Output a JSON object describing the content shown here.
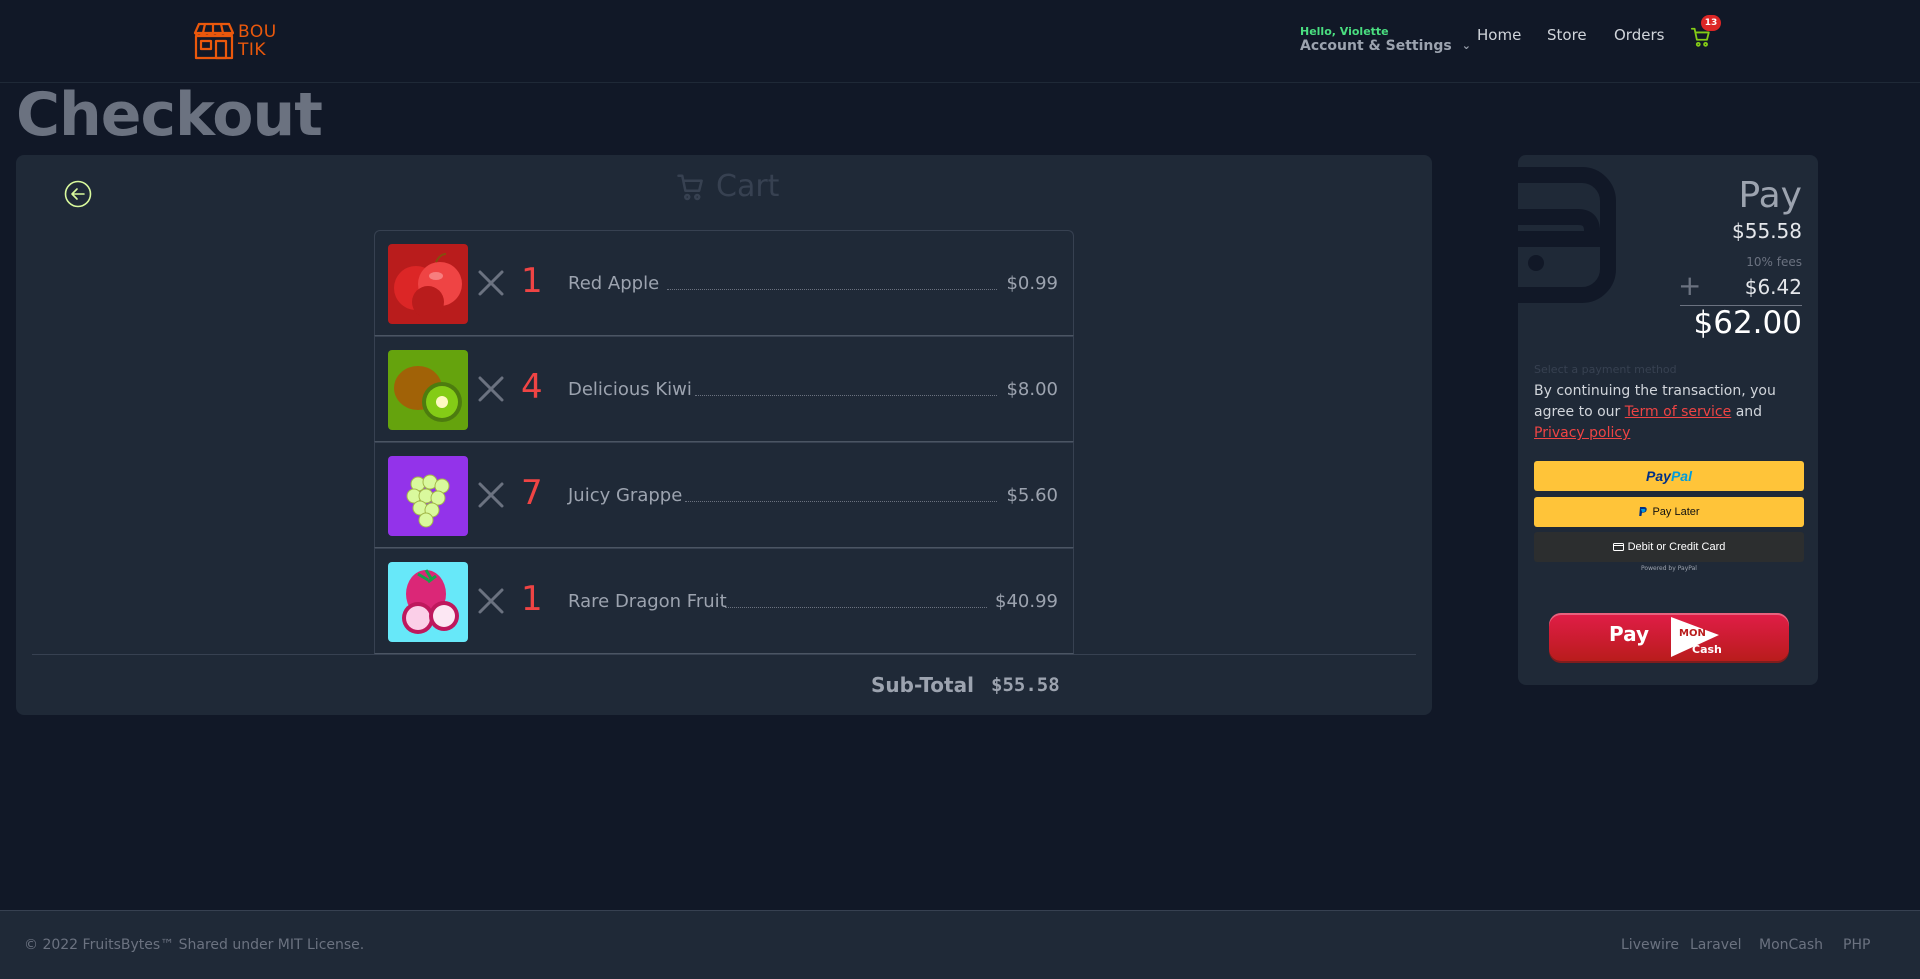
{
  "header": {
    "logo_text_1": "BOU",
    "logo_text_2": "TIK",
    "greeting": "Hello, Violette",
    "account_label": "Account & Settings",
    "nav": {
      "home": "Home",
      "store": "Store",
      "orders": "Orders"
    },
    "cart_count": "13"
  },
  "page_title": "Checkout",
  "cart": {
    "title": "Cart",
    "items": [
      {
        "qty": "1",
        "name": "Red Apple",
        "price": "$0.99"
      },
      {
        "qty": "4",
        "name": "Delicious Kiwi",
        "price": "$8.00"
      },
      {
        "qty": "7",
        "name": "Juicy Grappe",
        "price": "$5.60"
      },
      {
        "qty": "1",
        "name": "Rare Dragon Fruit",
        "price": "$40.99"
      }
    ],
    "subtotal_label": "Sub-Total",
    "subtotal_value": "$55.58"
  },
  "pay": {
    "title": "Pay",
    "amount": "$55.58",
    "fees_label": "10% fees",
    "fees_amount": "$6.42",
    "total": "$62.00",
    "method_label": "Select a payment method",
    "agree_text": "By continuing the transaction, you agree to our",
    "tos_link": "Term of service",
    "and_text": "and",
    "privacy_link": "Privacy policy",
    "paypal_1": "Pay",
    "paypal_2": "Pal",
    "paylater": "Pay Later",
    "card": "Debit or Credit Card",
    "powered": "Powered by PayPal",
    "moncash_pay": "Pay",
    "moncash_mon": "MON",
    "moncash_cash": "Cash"
  },
  "footer": {
    "copyright": "© 2022 FruitsBytes™ Shared under MIT License.",
    "links": [
      "Livewire",
      "Laravel",
      "MonCash",
      "PHP"
    ]
  },
  "colors": {
    "background": "#111827",
    "panel": "#1f2937",
    "accent_red": "#ef4444",
    "greeting_green": "#4ade80",
    "brand_orange": "#ea580c",
    "paypal_yellow": "#ffc439"
  }
}
